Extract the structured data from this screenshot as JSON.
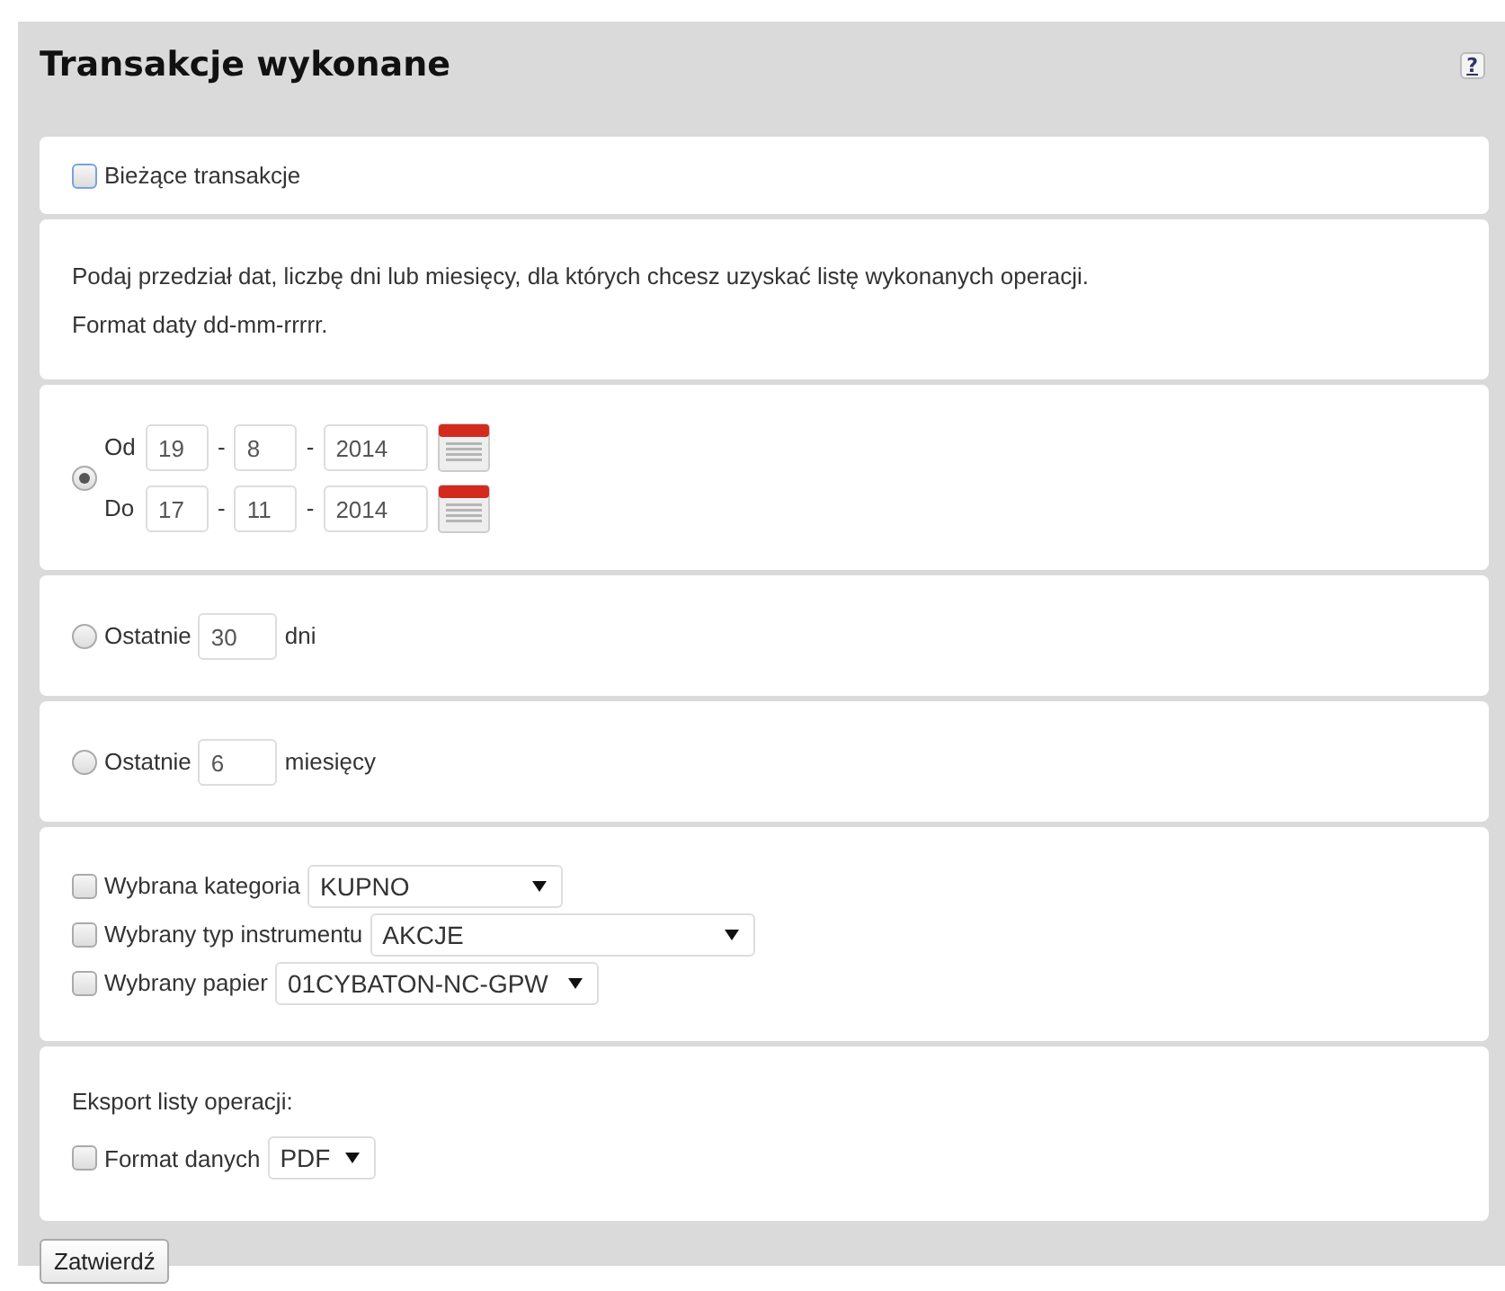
{
  "title": "Transakcje wykonane",
  "help": {
    "label": "?"
  },
  "current_transactions": {
    "label": "Bieżące transakcje",
    "checked": false
  },
  "intro": {
    "text": "Podaj przedział dat, liczbę dni lub miesięcy, dla których chcesz uzyskać listę wykonanych operacji.",
    "format_note": "Format daty dd-mm-rrrrr."
  },
  "date_range": {
    "selected": true,
    "rows": [
      {
        "label": "Od",
        "day": "19",
        "month": "8",
        "year": "2014",
        "separator": "-"
      },
      {
        "label": "Do",
        "day": "17",
        "month": "11",
        "year": "2014",
        "separator": "-"
      }
    ]
  },
  "last_days": {
    "selected": false,
    "label": "Ostatnie",
    "value": "30",
    "unit": "dni"
  },
  "last_months": {
    "selected": false,
    "label": "Ostatnie",
    "value": "6",
    "unit": "miesięcy"
  },
  "filters": [
    {
      "label": "Wybrana kategoria",
      "checked": false,
      "value": "KUPNO",
      "kind": "short"
    },
    {
      "label": "Wybrany typ instrumentu",
      "checked": false,
      "value": "AKCJE",
      "kind": "wide"
    },
    {
      "label": "Wybrany papier",
      "checked": false,
      "value": "01CYBATON-NC-GPW",
      "kind": "medium"
    }
  ],
  "export": {
    "heading": "Eksport listy operacji:",
    "label": "Format danych",
    "checked": false,
    "value": "PDF"
  },
  "submit": {
    "label": "Zatwierdź"
  }
}
